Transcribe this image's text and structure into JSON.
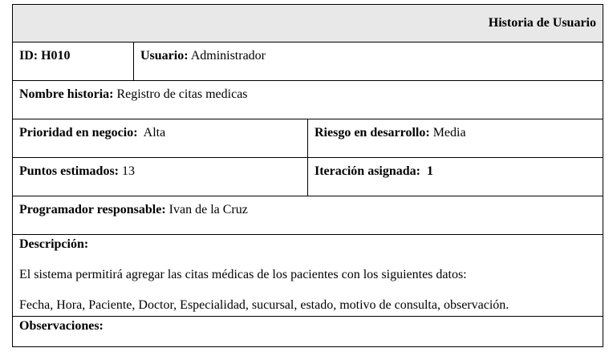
{
  "document": {
    "title": "Historia de Usuario",
    "id": {
      "label": "ID:",
      "value": "H010"
    },
    "usuario": {
      "label": "Usuario:",
      "value": "Administrador"
    },
    "nombre_historia": {
      "label": "Nombre historia:",
      "value": "Registro de citas medicas"
    },
    "prioridad": {
      "label": "Prioridad en negocio:",
      "value": "Alta"
    },
    "riesgo": {
      "label": "Riesgo en desarrollo:",
      "value": "Media"
    },
    "puntos": {
      "label": "Puntos estimados:",
      "value": "13"
    },
    "iteracion": {
      "label": "Iteración asignada:",
      "value": "1"
    },
    "programador": {
      "label": "Programador responsable:",
      "value": "Ivan de la Cruz"
    },
    "descripcion": {
      "label": "Descripción:",
      "line1": "El sistema permitirá agregar las citas médicas de los pacientes con los siguientes datos:",
      "line2": "Fecha, Hora, Paciente, Doctor, Especialidad, sucursal, estado, motivo de consulta, observación."
    },
    "observaciones": {
      "label": "Observaciones:"
    }
  }
}
